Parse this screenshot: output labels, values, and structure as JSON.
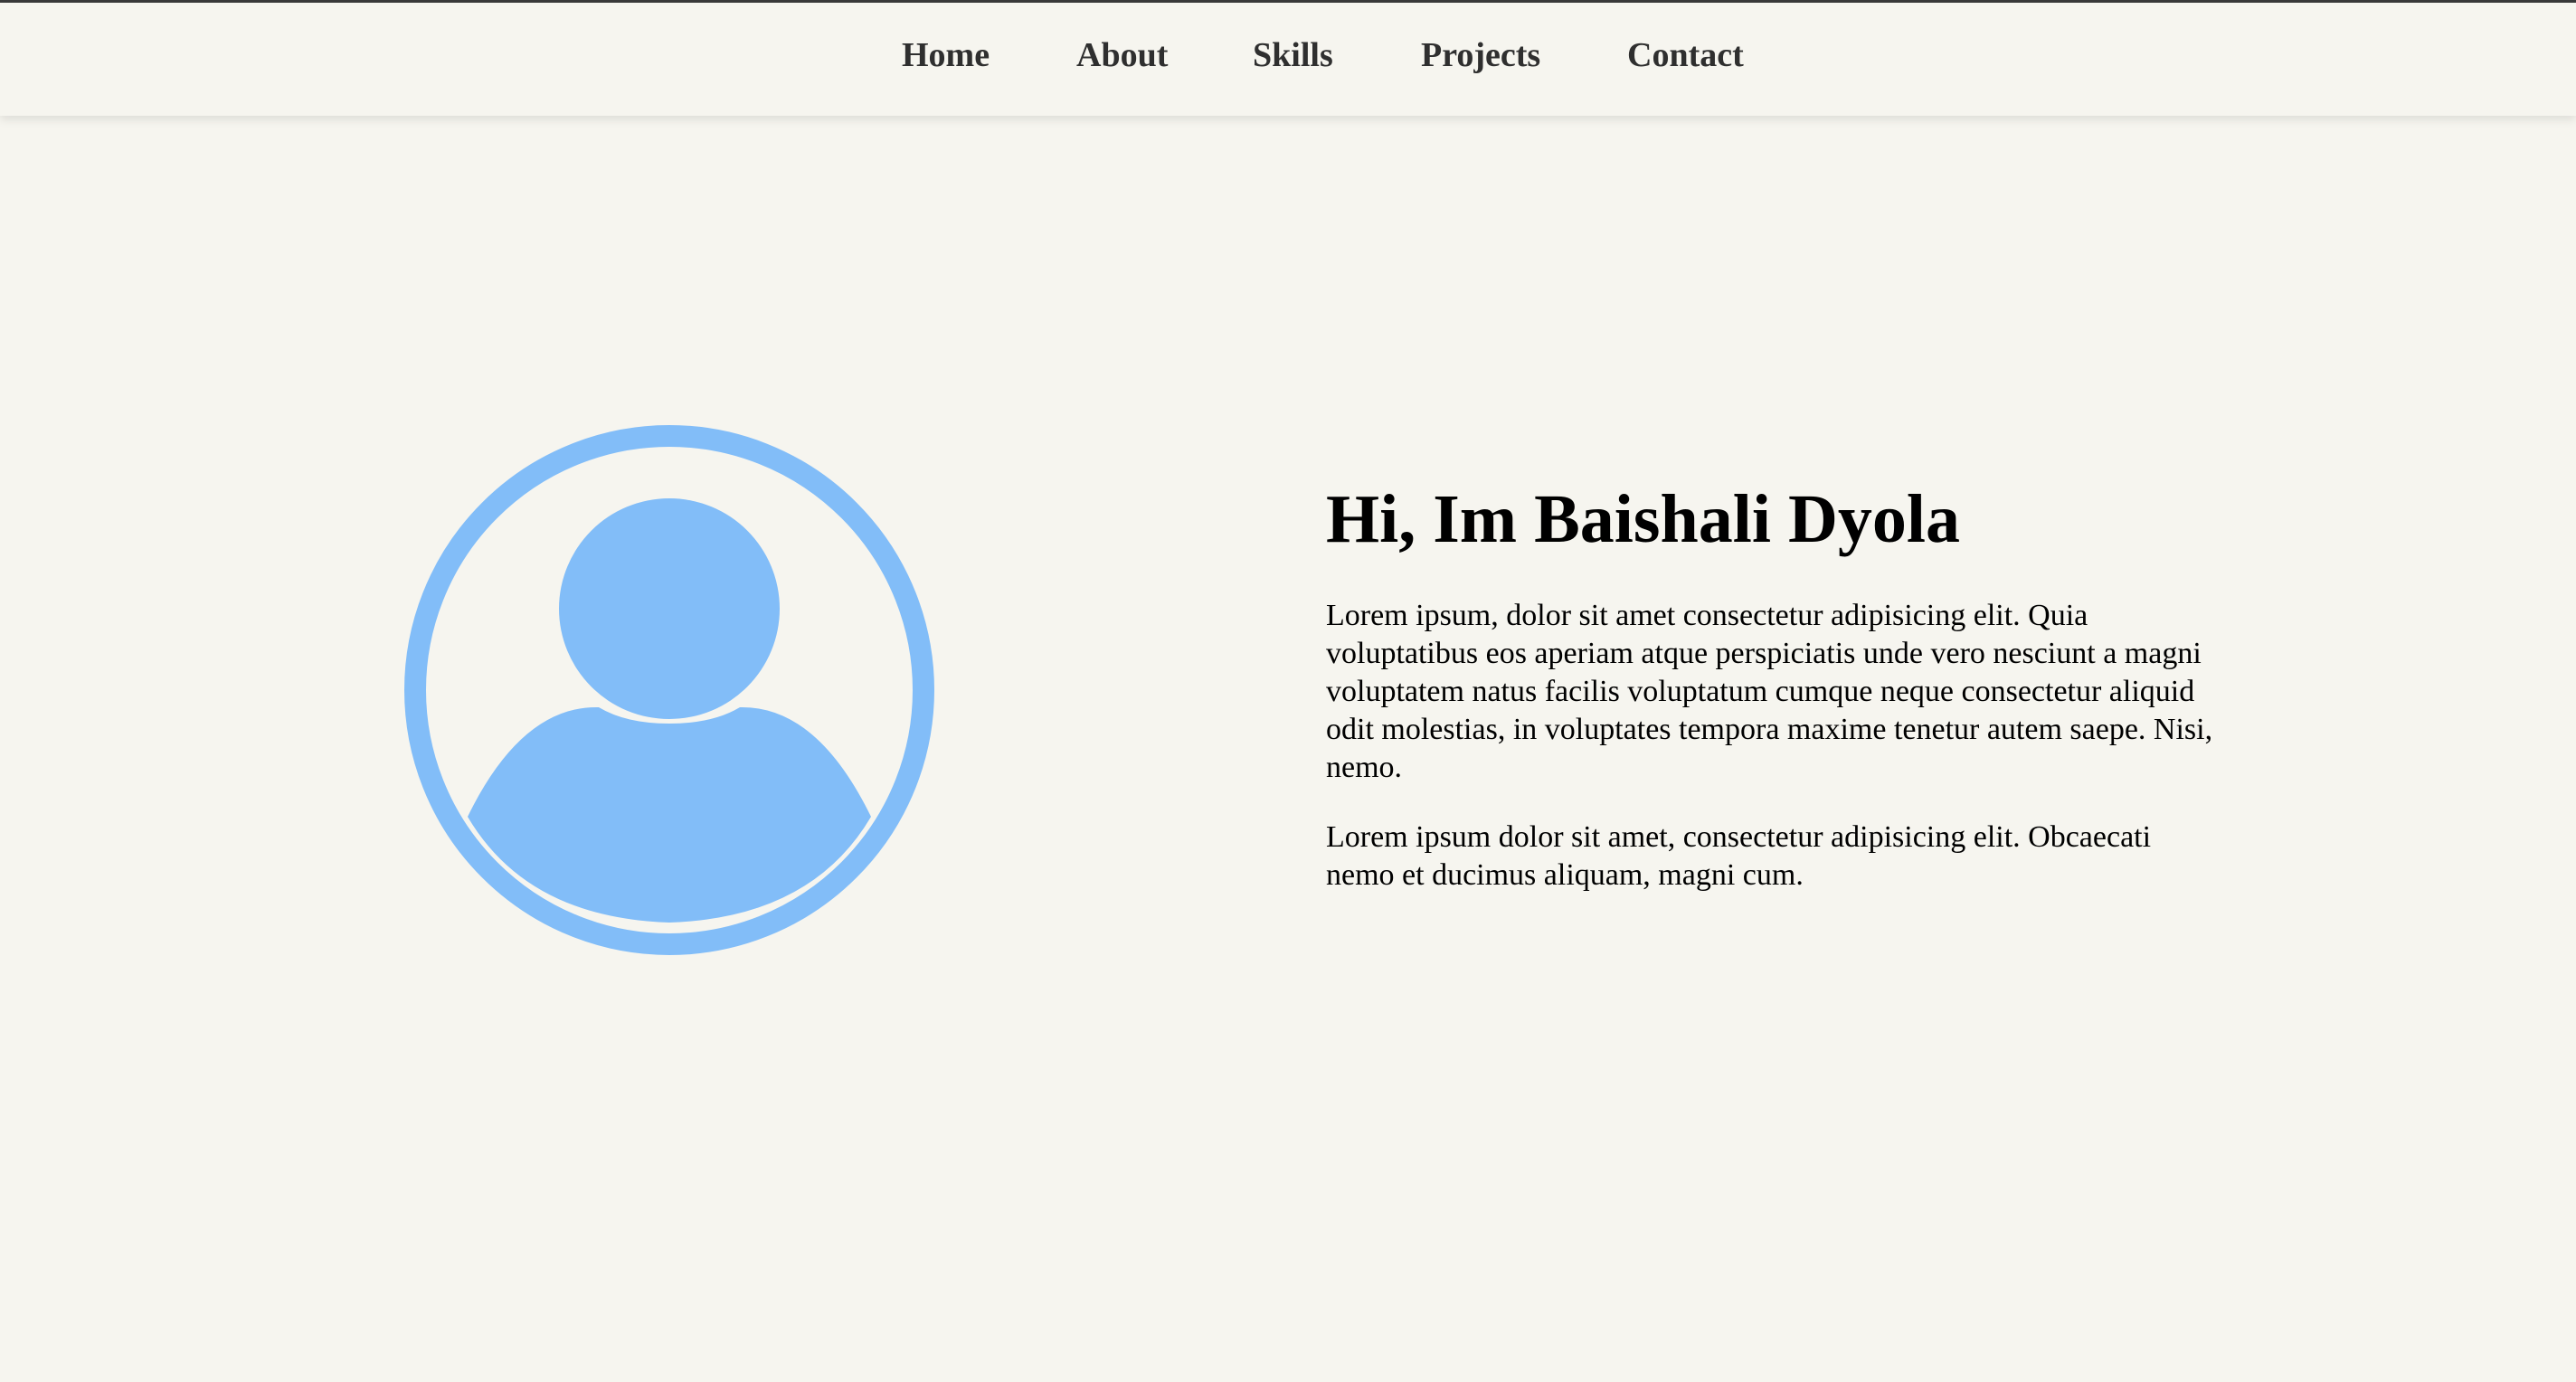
{
  "nav": {
    "items": [
      {
        "label": "Home"
      },
      {
        "label": "About"
      },
      {
        "label": "Skills"
      },
      {
        "label": "Projects"
      },
      {
        "label": "Contact"
      }
    ]
  },
  "hero": {
    "avatar_icon": "user-profile-icon",
    "accent_color": "#82bdf8",
    "title": "Hi, Im Baishali Dyola",
    "paragraphs": [
      "Lorem ipsum, dolor sit amet consectetur adipisicing elit. Quia voluptatibus eos aperiam atque perspiciatis unde vero nesciunt a magni voluptatem natus facilis voluptatum cumque neque consectetur aliquid odit molestias, in voluptates tempora maxime tenetur autem saepe. Nisi, nemo.",
      "Lorem ipsum dolor sit amet, consectetur adipisicing elit. Obcaecati nemo et ducimus aliquam, magni cum."
    ]
  },
  "colors": {
    "background": "#f6f5ef",
    "nav_text": "#2f2f2f",
    "text": "#000000"
  }
}
